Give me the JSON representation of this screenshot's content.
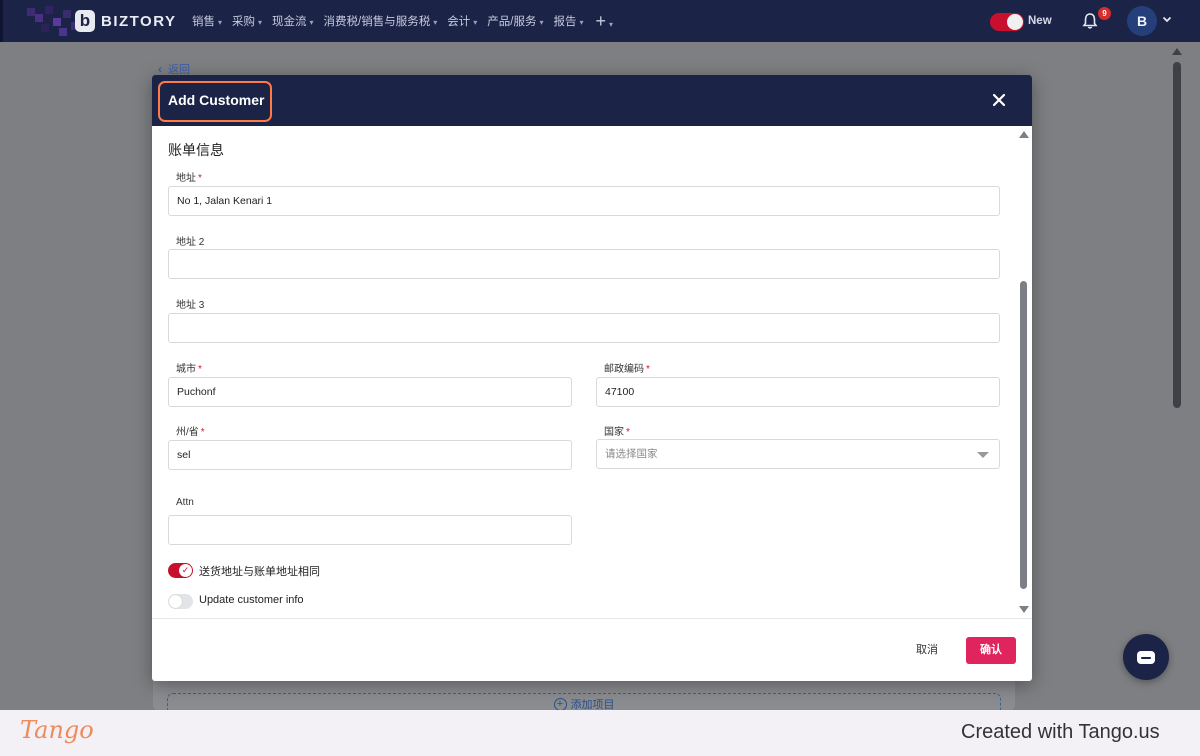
{
  "app": {
    "brand": "BIZTORY",
    "brand_letter": "b",
    "nav": [
      {
        "label": "销售"
      },
      {
        "label": "采购"
      },
      {
        "label": "现金流"
      },
      {
        "label": "消费税/销售与服务税"
      },
      {
        "label": "会计"
      },
      {
        "label": "产品/服务"
      },
      {
        "label": "报告"
      }
    ],
    "nav_plus": "+",
    "new_toggle_label": "New",
    "notification_count": "9",
    "avatar_initial": "B",
    "back_link": "返回",
    "add_item": "添加项目"
  },
  "modal": {
    "title": "Add Customer",
    "section_title": "账单信息",
    "fields": {
      "address1": {
        "label": "地址",
        "value": "No 1, Jalan Kenari 1",
        "required": true
      },
      "address2": {
        "label": "地址 2",
        "value": ""
      },
      "address3": {
        "label": "地址 3",
        "value": ""
      },
      "city": {
        "label": "城市",
        "value": "Puchonf",
        "required": true
      },
      "postcode": {
        "label": "邮政编码",
        "value": "47100",
        "required": true
      },
      "state": {
        "label": "州/省",
        "value": "sel",
        "required": true
      },
      "country": {
        "label": "国家",
        "placeholder": "请选择国家",
        "required": true
      },
      "attn": {
        "label": "Attn",
        "value": ""
      }
    },
    "required_mark": "*",
    "same_shipping": {
      "label": "送货地址与账单地址相同",
      "checked": true
    },
    "update_customer": {
      "label": "Update customer info",
      "checked": false
    },
    "cancel_label": "取消",
    "confirm_label": "确认"
  },
  "footer": {
    "tango_logo": "Tango",
    "credit": "Created with Tango.us"
  },
  "colors": {
    "nav_bg": "#1b2346",
    "accent_red": "#c8102e",
    "confirm_pink": "#e0245e",
    "highlight_orange": "#ff7a45",
    "tango_orange": "#ef8a5a"
  }
}
